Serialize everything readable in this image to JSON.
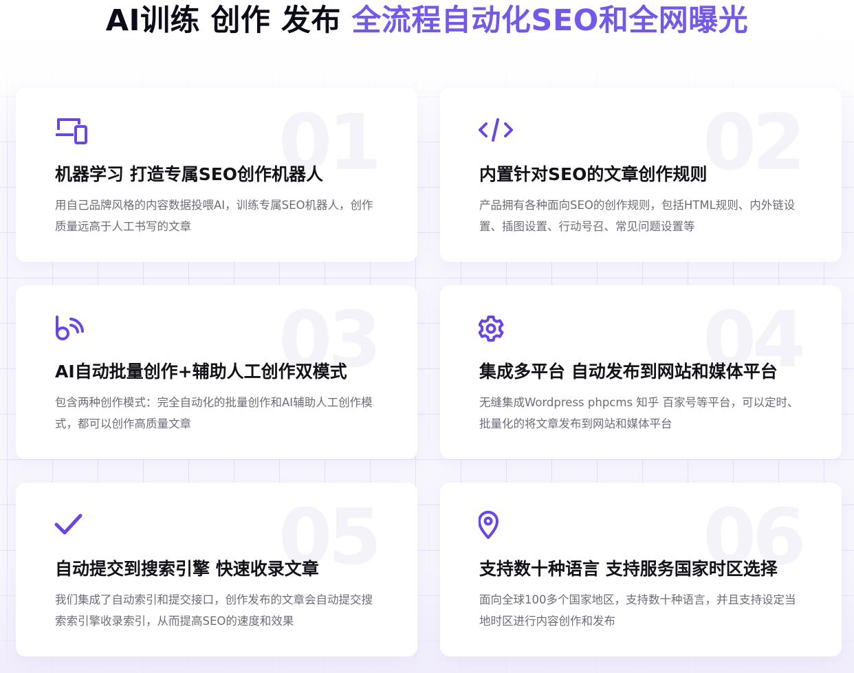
{
  "headline": {
    "dark": "AI训练 创作 发布 ",
    "accent": "全流程自动化SEO和全网曝光"
  },
  "colors": {
    "accent": "#7458ec",
    "icon": "#6a45e6",
    "title": "#121218",
    "text": "#6c6c78"
  },
  "features": [
    {
      "number": "01",
      "icon": "devices-icon",
      "title": "机器学习 打造专属SEO创作机器人",
      "desc": "用自己品牌风格的内容数据投喂AI，训练专属SEO机器人，创作质量远高于人工书写的文章"
    },
    {
      "number": "02",
      "icon": "code-icon",
      "title": "内置针对SEO的文章创作规则",
      "desc": "产品拥有各种面向SEO的创作规则，包括HTML规则、内外链设置、插图设置、行动号召、常见问题设置等"
    },
    {
      "number": "03",
      "icon": "broadcast-icon",
      "title": "AI自动批量创作+辅助人工创作双模式",
      "desc": "包含两种创作模式：完全自动化的批量创作和AI辅助人工创作模式，都可以创作高质量文章"
    },
    {
      "number": "04",
      "icon": "gear-icon",
      "title": "集成多平台 自动发布到网站和媒体平台",
      "desc": "无缝集成Wordpress phpcms 知乎 百家号等平台，可以定时、批量化的将文章发布到网站和媒体平台"
    },
    {
      "number": "05",
      "icon": "checkmark-icon",
      "title": "自动提交到搜索引擎 快速收录文章",
      "desc": "我们集成了自动索引和提交接口，创作发布的文章会自动提交搜索索引擎收录索引，从而提高SEO的速度和效果"
    },
    {
      "number": "06",
      "icon": "location-pin-icon",
      "title": "支持数十种语言 支持服务国家时区选择",
      "desc": "面向全球100多个国家地区，支持数十种语言，并且支持设定当地时区进行内容创作和发布"
    }
  ]
}
